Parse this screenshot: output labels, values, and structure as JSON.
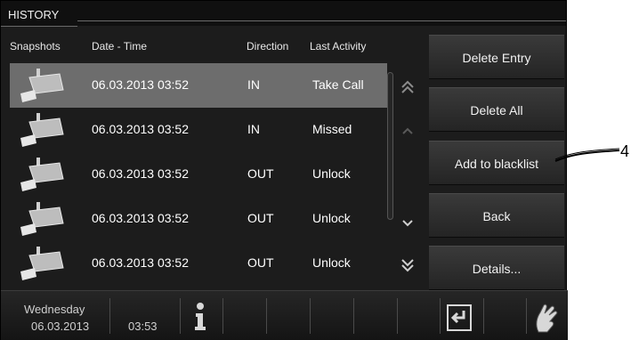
{
  "title": "HISTORY",
  "columns": {
    "snapshots": "Snapshots",
    "datetime": "Date - Time",
    "direction": "Direction",
    "activity": "Last Activity"
  },
  "rows": [
    {
      "datetime": "06.03.2013 03:52",
      "direction": "IN",
      "activity": "Take Call",
      "selected": true
    },
    {
      "datetime": "06.03.2013 03:52",
      "direction": "IN",
      "activity": "Missed",
      "selected": false
    },
    {
      "datetime": "06.03.2013 03:52",
      "direction": "OUT",
      "activity": "Unlock",
      "selected": false
    },
    {
      "datetime": "06.03.2013 03:52",
      "direction": "OUT",
      "activity": "Unlock",
      "selected": false
    },
    {
      "datetime": "06.03.2013 03:52",
      "direction": "OUT",
      "activity": "Unlock",
      "selected": false
    }
  ],
  "buttons": {
    "delete_entry": "Delete Entry",
    "delete_all": "Delete All",
    "add_blacklist": "Add to blacklist",
    "back": "Back",
    "details": "Details..."
  },
  "status": {
    "day": "Wednesday",
    "date": "06.03.2013",
    "time": "03:53"
  },
  "icons": {
    "snapshot": "camera-icon",
    "scroll_top": "double-chevron-up-icon",
    "scroll_up": "chevron-up-icon",
    "scroll_down": "chevron-down-icon",
    "scroll_bottom": "double-chevron-down-icon",
    "info": "info-icon",
    "return": "return-icon",
    "clean": "cleaning-hand-icon"
  },
  "callout": "4",
  "colors": {
    "screen_bg": "#1c1c1c",
    "selected_row": "#6d6d6d",
    "text": "#ffffff"
  }
}
